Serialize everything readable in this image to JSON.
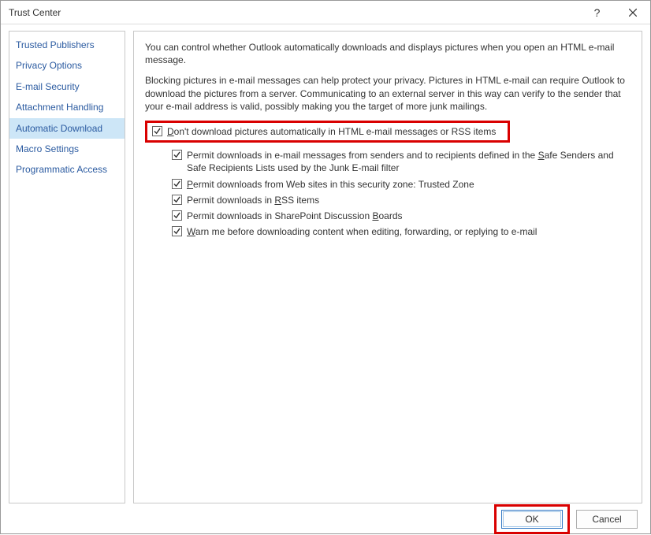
{
  "window": {
    "title": "Trust Center"
  },
  "sidebar": {
    "items": [
      {
        "label": "Trusted Publishers"
      },
      {
        "label": "Privacy Options"
      },
      {
        "label": "E-mail Security"
      },
      {
        "label": "Attachment Handling"
      },
      {
        "label": "Automatic Download"
      },
      {
        "label": "Macro Settings"
      },
      {
        "label": "Programmatic Access"
      }
    ],
    "selected_index": 4
  },
  "main": {
    "intro1": "You can control whether Outlook automatically downloads and displays pictures when you open an HTML e-mail message.",
    "intro2": "Blocking pictures in e-mail messages can help protect your privacy. Pictures in HTML e-mail can require Outlook to download the pictures from a server. Communicating to an external server in this way can verify to the sender that your e-mail address is valid, possibly making you the target of more junk mailings.",
    "master_checkbox": {
      "checked": true,
      "pre": "",
      "key": "D",
      "rest": "on't download pictures automatically in HTML e-mail messages or RSS items"
    },
    "sub_checkboxes": [
      {
        "checked": true,
        "pre": "Permit downloads in e-mail messages from senders and to recipients defined in the ",
        "key": "S",
        "rest": "afe Senders and Safe Recipients Lists used by the Junk E-mail filter"
      },
      {
        "checked": true,
        "pre": "",
        "key": "P",
        "rest": "ermit downloads from Web sites in this security zone: Trusted Zone"
      },
      {
        "checked": true,
        "pre": "Permit downloads in ",
        "key": "R",
        "rest": "SS items"
      },
      {
        "checked": true,
        "pre": "Permit downloads in SharePoint Discussion ",
        "key": "B",
        "rest": "oards"
      },
      {
        "checked": true,
        "pre": "",
        "key": "W",
        "rest": "arn me before downloading content when editing, forwarding, or replying to e-mail"
      }
    ]
  },
  "footer": {
    "ok": "OK",
    "cancel": "Cancel"
  }
}
